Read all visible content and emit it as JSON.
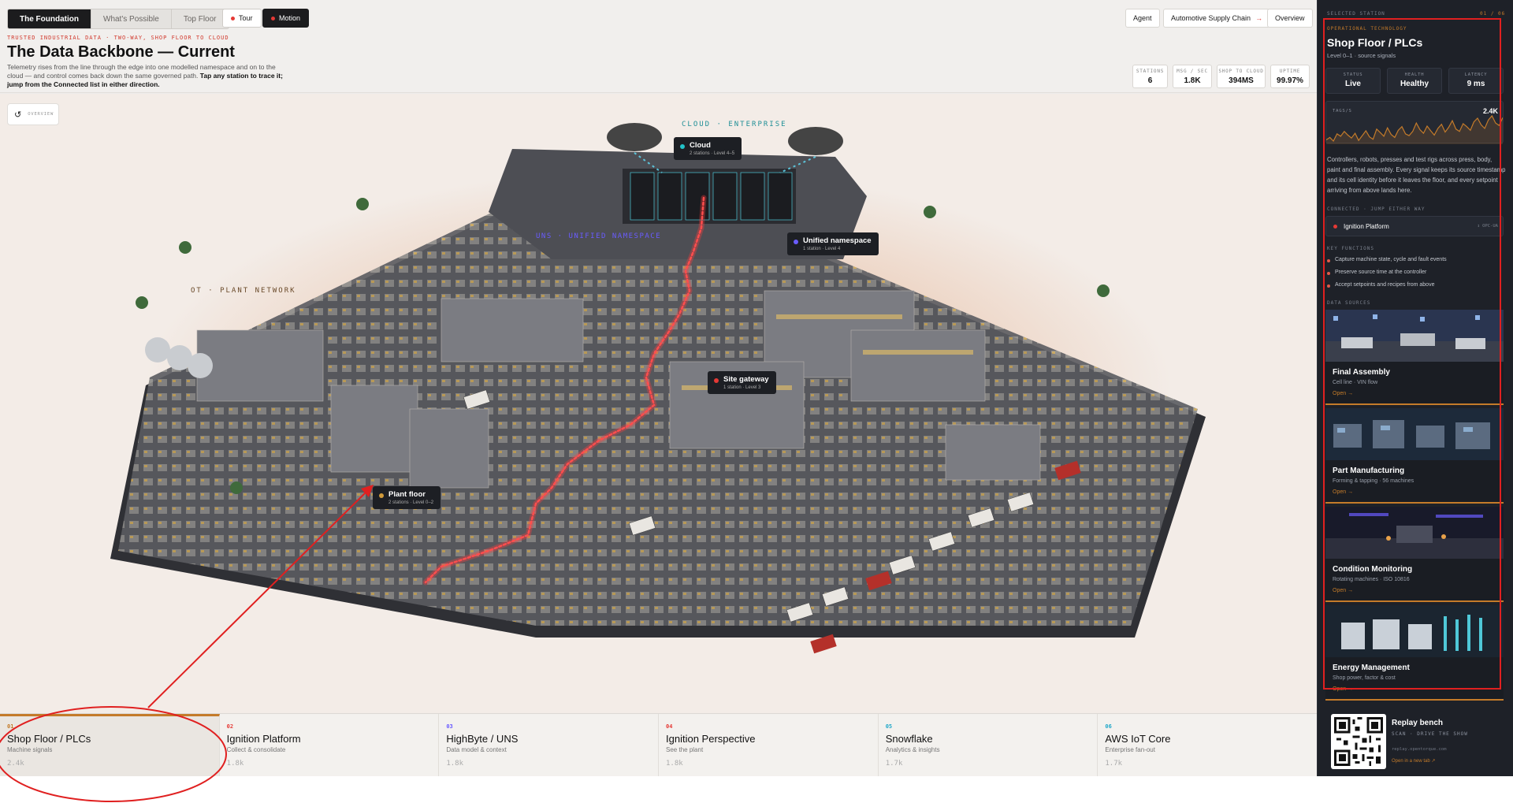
{
  "header": {
    "tabs": [
      {
        "label": "The Foundation",
        "active": true
      },
      {
        "label": "What's Possible",
        "active": false
      },
      {
        "label": "Top Floor",
        "active": false
      }
    ],
    "tour_label": "Tour",
    "motion_label": "Motion",
    "right_buttons": {
      "agent": "Agent",
      "supply_chain": "Automotive Supply Chain",
      "supply_chain_arrow": "→",
      "overview": "Overview"
    },
    "eyebrow": "TRUSTED INDUSTRIAL DATA · TWO-WAY, SHOP FLOOR TO CLOUD",
    "title": "The Data Backbone — Current",
    "description": "Telemetry rises from the line through the edge into one modelled namespace and on to the cloud — and control comes back down the same governed path.",
    "description_bold": "Tap any station to trace it; jump from the Connected list in either direction.",
    "stats": [
      {
        "label": "STATIONS",
        "value": "6"
      },
      {
        "label": "MSG / SEC",
        "value": "1.8K"
      },
      {
        "label": "SHOP TO CLOUD",
        "value": "394MS"
      },
      {
        "label": "UPTIME",
        "value": "99.97%"
      }
    ]
  },
  "scene": {
    "overview_label": "OVERVIEW",
    "zones": {
      "cloud": "CLOUD · ENTERPRISE",
      "uns": "UNS · UNIFIED NAMESPACE",
      "ot": "OT · PLANT NETWORK"
    },
    "callouts": [
      {
        "title": "Cloud",
        "sub": "2 stations · Level 4–5",
        "color": "#22c3c9"
      },
      {
        "title": "Unified namespace",
        "sub": "1 station · Level 4",
        "color": "#6a5cff"
      },
      {
        "title": "Site gateway",
        "sub": "1 station · Level 3",
        "color": "#e53935"
      },
      {
        "title": "Plant floor",
        "sub": "2 stations · Level 0–2",
        "color": "#d09a3a"
      }
    ]
  },
  "stations": [
    {
      "num": "01",
      "name": "Shop Floor / PLCs",
      "sub": "Machine signals",
      "value": "2.4k",
      "color": "#c47b2a",
      "active": true
    },
    {
      "num": "02",
      "name": "Ignition Platform",
      "sub": "Collect & consolidate",
      "value": "1.8k",
      "color": "#e53935",
      "active": false
    },
    {
      "num": "03",
      "name": "HighByte / UNS",
      "sub": "Data model & context",
      "value": "1.8k",
      "color": "#6a5cff",
      "active": false
    },
    {
      "num": "04",
      "name": "Ignition Perspective",
      "sub": "See the plant",
      "value": "1.8k",
      "color": "#e53935",
      "active": false
    },
    {
      "num": "05",
      "name": "Snowflake",
      "sub": "Analytics & insights",
      "value": "1.7k",
      "color": "#22a8c9",
      "active": false
    },
    {
      "num": "06",
      "name": "AWS IoT Core",
      "sub": "Enterprise fan-out",
      "value": "1.7k",
      "color": "#22a8c9",
      "active": false
    }
  ],
  "panel": {
    "eyebrow": "SELECTED STATION",
    "counter": "01 / 06",
    "category": "OPERATIONAL TECHNOLOGY",
    "title": "Shop Floor / PLCs",
    "subtitle": "Level 0–1 · source signals",
    "tiles": [
      {
        "label": "STATUS",
        "value": "Live"
      },
      {
        "label": "HEALTH",
        "value": "Healthy"
      },
      {
        "label": "LATENCY",
        "value": "9 ms"
      }
    ],
    "sparkline": {
      "label": "TAGS/S",
      "value": "2.4K",
      "points": [
        30,
        34,
        28,
        40,
        36,
        44,
        38,
        33,
        41,
        29,
        37,
        45,
        35,
        31,
        48,
        42,
        36,
        50,
        39,
        34,
        46,
        52,
        40,
        37,
        44,
        58,
        47,
        41,
        53,
        45,
        38,
        49,
        56,
        43,
        51,
        62,
        48,
        44,
        57,
        52,
        46,
        60,
        66,
        55,
        49,
        63,
        70,
        58,
        54,
        67
      ]
    },
    "description": "Controllers, robots, presses and test rigs across press, body, paint and final assembly. Every signal keeps its source timestamp and its cell identity before it leaves the floor, and every setpoint arriving from above lands here.",
    "connected_label": "CONNECTED · JUMP EITHER WAY",
    "connected": {
      "name": "Ignition Platform",
      "tag": "↕ OPC-UA"
    },
    "functions_label": "KEY FUNCTIONS",
    "functions": [
      "Capture machine state, cycle and fault events",
      "Preserve source time at the controller",
      "Accept setpoints and recipes from above"
    ],
    "sources_label": "DATA SOURCES",
    "sources": [
      {
        "title": "Final Assembly",
        "sub": "Cell line · VIN flow",
        "open": "Open →"
      },
      {
        "title": "Part Manufacturing",
        "sub": "Forming & tapping · 56 machines",
        "open": "Open →"
      },
      {
        "title": "Condition Monitoring",
        "sub": "Rotating machines · ISO 10816",
        "open": "Open →"
      },
      {
        "title": "Energy Management",
        "sub": "Shop power, factor & cost",
        "open": "Open →"
      }
    ]
  },
  "replay": {
    "title": "Replay bench",
    "sub": "SCAN · DRIVE THE SHOW",
    "url": "replay.opentorque.com",
    "open": "Open in a new tab ↗"
  },
  "colors": {
    "accent": "#c47b2a",
    "annotation": "#e02020",
    "panel_bg": "#1e2128",
    "primary_dark": "#1c1c1e"
  }
}
